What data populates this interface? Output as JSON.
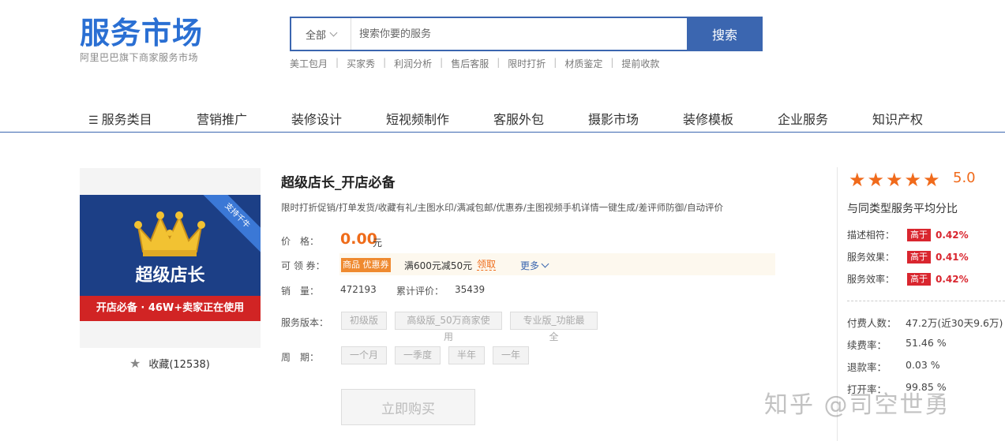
{
  "header": {
    "logo_text": "服务市场",
    "logo_subtitle": "阿里巴巴旗下商家服务市场",
    "search": {
      "category": "全部",
      "placeholder": "搜索你要的服务",
      "button_label": "搜索"
    },
    "hot_tags": [
      "美工包月",
      "买家秀",
      "利润分析",
      "售后客服",
      "限时打折",
      "材质鉴定",
      "提前收款"
    ]
  },
  "nav": {
    "items": [
      "服务类目",
      "营销推广",
      "装修设计",
      "短视频制作",
      "客服外包",
      "摄影市场",
      "装修模板",
      "企业服务",
      "知识产权"
    ]
  },
  "product": {
    "image": {
      "corner_text": "支持千牛",
      "title": "超级店长",
      "strip_text": "开店必备 · 46W+卖家正在使用"
    },
    "favorite_label": "收藏(12538)",
    "title": "超级店长_开店必备",
    "description": "限时打折促销/打单发货/收藏有礼/主图水印/满减包邮/优惠券/主图视频手机详情一键生成/差评师防御/自动评价",
    "price_label": "价　格：",
    "price": "0.00",
    "price_unit": "元",
    "coupon_label": "可 领 券：",
    "coupon_badge": "商品 优惠券",
    "coupon_text": "满600元减50元",
    "coupon_claim": "领取",
    "coupon_more": "更多",
    "sales_label": "销　量：",
    "sales_value": "472193",
    "reviews_label": "累计评价：",
    "reviews_value": "35439",
    "version_label": "服务版本：",
    "versions": [
      "初级版",
      "高级版_50万商家使用",
      "专业版_功能最全"
    ],
    "period_label": "周　期：",
    "periods": [
      "一个月",
      "一季度",
      "半年",
      "一年"
    ],
    "buy_label": "立即购买"
  },
  "rating": {
    "stars": 5,
    "score": "5.0",
    "compare_title": "与同类型服务平均分比",
    "metrics": [
      {
        "label": "描述相符：",
        "badge": "高于",
        "value": "0.42%"
      },
      {
        "label": "服务效果：",
        "badge": "高于",
        "value": "0.41%"
      },
      {
        "label": "服务效率：",
        "badge": "高于",
        "value": "0.42%"
      }
    ],
    "stats": [
      {
        "label": "付费人数：",
        "value": "47.2万(近30天9.6万)"
      },
      {
        "label": "续费率：",
        "value": "51.46 %"
      },
      {
        "label": "退款率：",
        "value": "0.03 %"
      },
      {
        "label": "打开率：",
        "value": "99.85 %"
      }
    ]
  },
  "watermark": "知乎 @司空世勇",
  "colors": {
    "brand": "#3b66b0",
    "accent": "#ef6c1a",
    "badge_red": "#d9262f",
    "logo": "#2a6fd3"
  }
}
